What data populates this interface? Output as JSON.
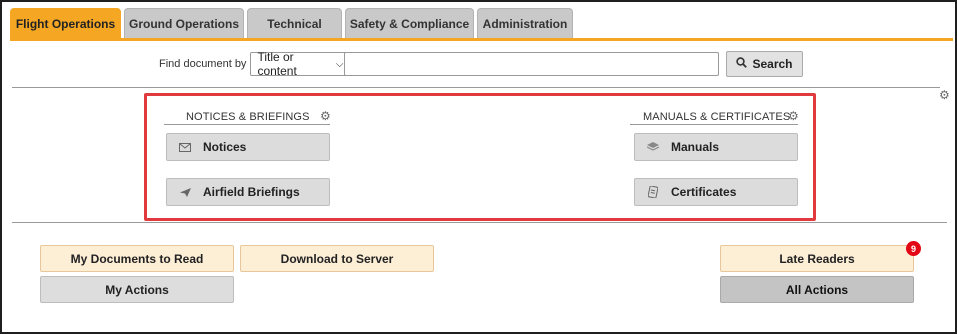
{
  "tabs": [
    {
      "label": "Flight Operations",
      "active": true
    },
    {
      "label": "Ground Operations",
      "active": false
    },
    {
      "label": "Technical",
      "active": false
    },
    {
      "label": "Safety & Compliance",
      "active": false
    },
    {
      "label": "Administration",
      "active": false
    }
  ],
  "search": {
    "find_label": "Find document by",
    "select_value": "Title or content",
    "query_value": "",
    "button_label": "Search"
  },
  "sections": {
    "notices": {
      "title": "NOTICES & BRIEFINGS",
      "items": [
        {
          "label": "Notices",
          "icon": "envelope-icon"
        },
        {
          "label": "Airfield Briefings",
          "icon": "paper-plane-icon"
        }
      ]
    },
    "manuals": {
      "title": "MANUALS & CERTIFICATES",
      "items": [
        {
          "label": "Manuals",
          "icon": "layers-icon"
        },
        {
          "label": "Certificates",
          "icon": "certificate-icon"
        }
      ]
    }
  },
  "actions": {
    "my_documents": "My Documents to Read",
    "download": "Download to Server",
    "my_actions": "My Actions",
    "late_readers": "Late Readers",
    "late_readers_count": "9",
    "all_actions": "All Actions"
  },
  "colors": {
    "accent": "#f5a623",
    "highlight": "#e03a3e",
    "badge": "#e30613",
    "cream": "#fdeed6"
  }
}
